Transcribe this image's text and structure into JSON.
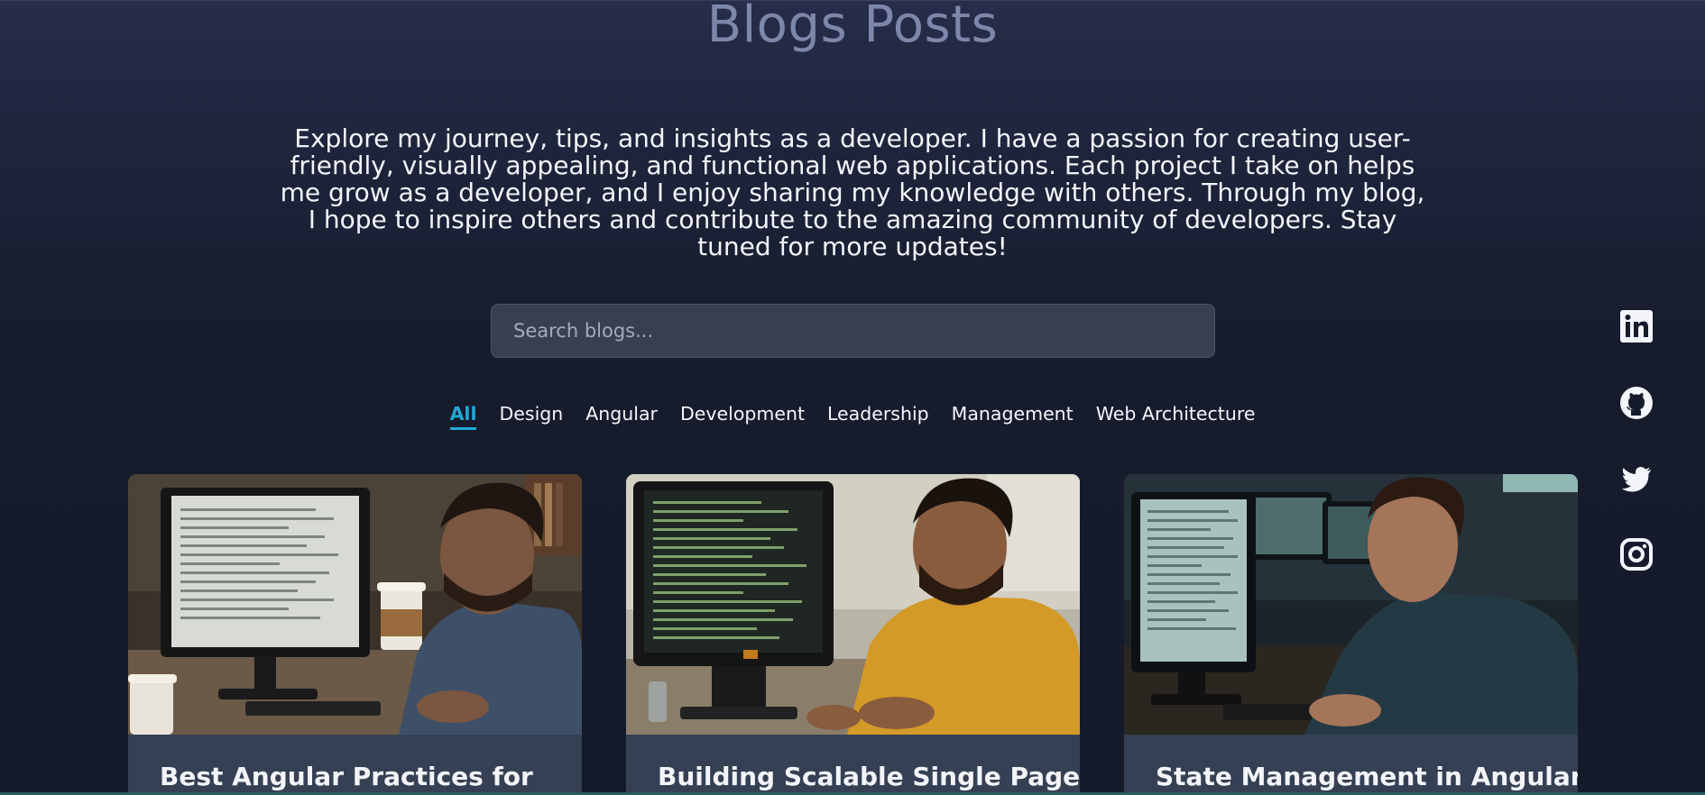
{
  "header": {
    "title": "Blogs Posts",
    "intro": "Explore my journey, tips, and insights as a developer. I have a passion for creating user-friendly, visually appealing, and functional web applications. Each project I take on helps me grow as a developer, and I enjoy sharing my knowledge with others. Through my blog, I hope to inspire others and contribute to the amazing community of developers. Stay tuned for more updates!"
  },
  "search": {
    "placeholder": "Search blogs...",
    "value": ""
  },
  "filters": [
    {
      "label": "All",
      "active": true
    },
    {
      "label": "Design",
      "active": false
    },
    {
      "label": "Angular",
      "active": false
    },
    {
      "label": "Development",
      "active": false
    },
    {
      "label": "Leadership",
      "active": false
    },
    {
      "label": "Management",
      "active": false
    },
    {
      "label": "Web Architecture",
      "active": false
    }
  ],
  "cards": [
    {
      "title": "Best Angular Practices for",
      "shirt_color": "#3e5068"
    },
    {
      "title": "Building Scalable Single Page",
      "shirt_color": "#d49a28"
    },
    {
      "title": "State Management in Angular:",
      "shirt_color": "#233a45"
    }
  ],
  "social": [
    {
      "name": "linkedin-icon"
    },
    {
      "name": "github-icon"
    },
    {
      "name": "twitter-icon"
    },
    {
      "name": "instagram-icon"
    }
  ],
  "colors": {
    "accent": "#22a9d6",
    "card_body": "#364054",
    "background": "#151b2b"
  }
}
